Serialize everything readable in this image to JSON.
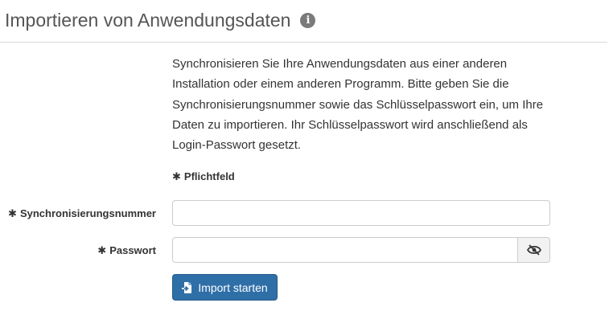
{
  "page": {
    "title": "Importieren von Anwendungsdaten",
    "info_icon": "info-circle-icon"
  },
  "description": "Synchronisieren Sie Ihre Anwendungsdaten aus einer anderen Installation oder einem anderen Programm. Bitte geben Sie die Synchronisierungsnummer sowie das Schlüsselpasswort ein, um Ihre Daten zu importieren. Ihr Schlüsselpasswort wird anschließend als Login-Passwort gesetzt.",
  "required_note": {
    "marker": "✱",
    "label": "Pflichtfeld"
  },
  "form": {
    "sync_number": {
      "marker": "✱",
      "label": "Synchronisierungsnummer",
      "value": ""
    },
    "password": {
      "marker": "✱",
      "label": "Passwort",
      "value": "",
      "toggle_icon": "eye-slash-icon"
    },
    "submit": {
      "label": "Import starten",
      "icon": "file-import-icon"
    }
  },
  "colors": {
    "primary_button": "#2f6fa8",
    "title_text": "#555555"
  }
}
